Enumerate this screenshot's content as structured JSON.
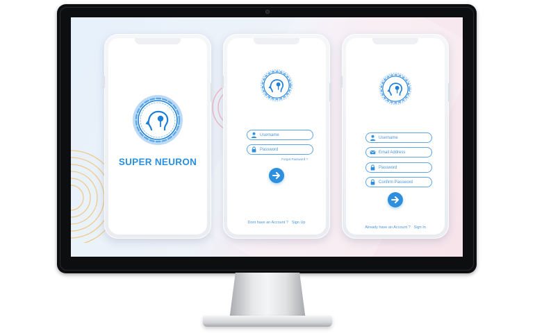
{
  "splash": {
    "brand": "SUPER NEURON"
  },
  "login": {
    "username_placeholder": "Username",
    "password_placeholder": "Password",
    "forgot": "Forgot Password ?",
    "footer_text": "Dont have an Account ?",
    "footer_action": "Sign Up"
  },
  "signup": {
    "username_placeholder": "Username",
    "email_placeholder": "Email Address",
    "password_placeholder": "Password",
    "confirm_placeholder": "Confirm Password",
    "footer_text": "Already have an Account ?",
    "footer_action": "Sign In"
  },
  "icons": {
    "logo": "brain-head-icon",
    "user": "user-icon",
    "lock": "lock-icon",
    "email": "envelope-icon",
    "next": "arrow-right-icon"
  },
  "colors": {
    "accent": "#2f8fdf",
    "brand_text": "#2a8fe0",
    "field_border": "#5ba4e6",
    "deco_pink": "#f2b3bd",
    "deco_gold": "#f0c98a"
  }
}
